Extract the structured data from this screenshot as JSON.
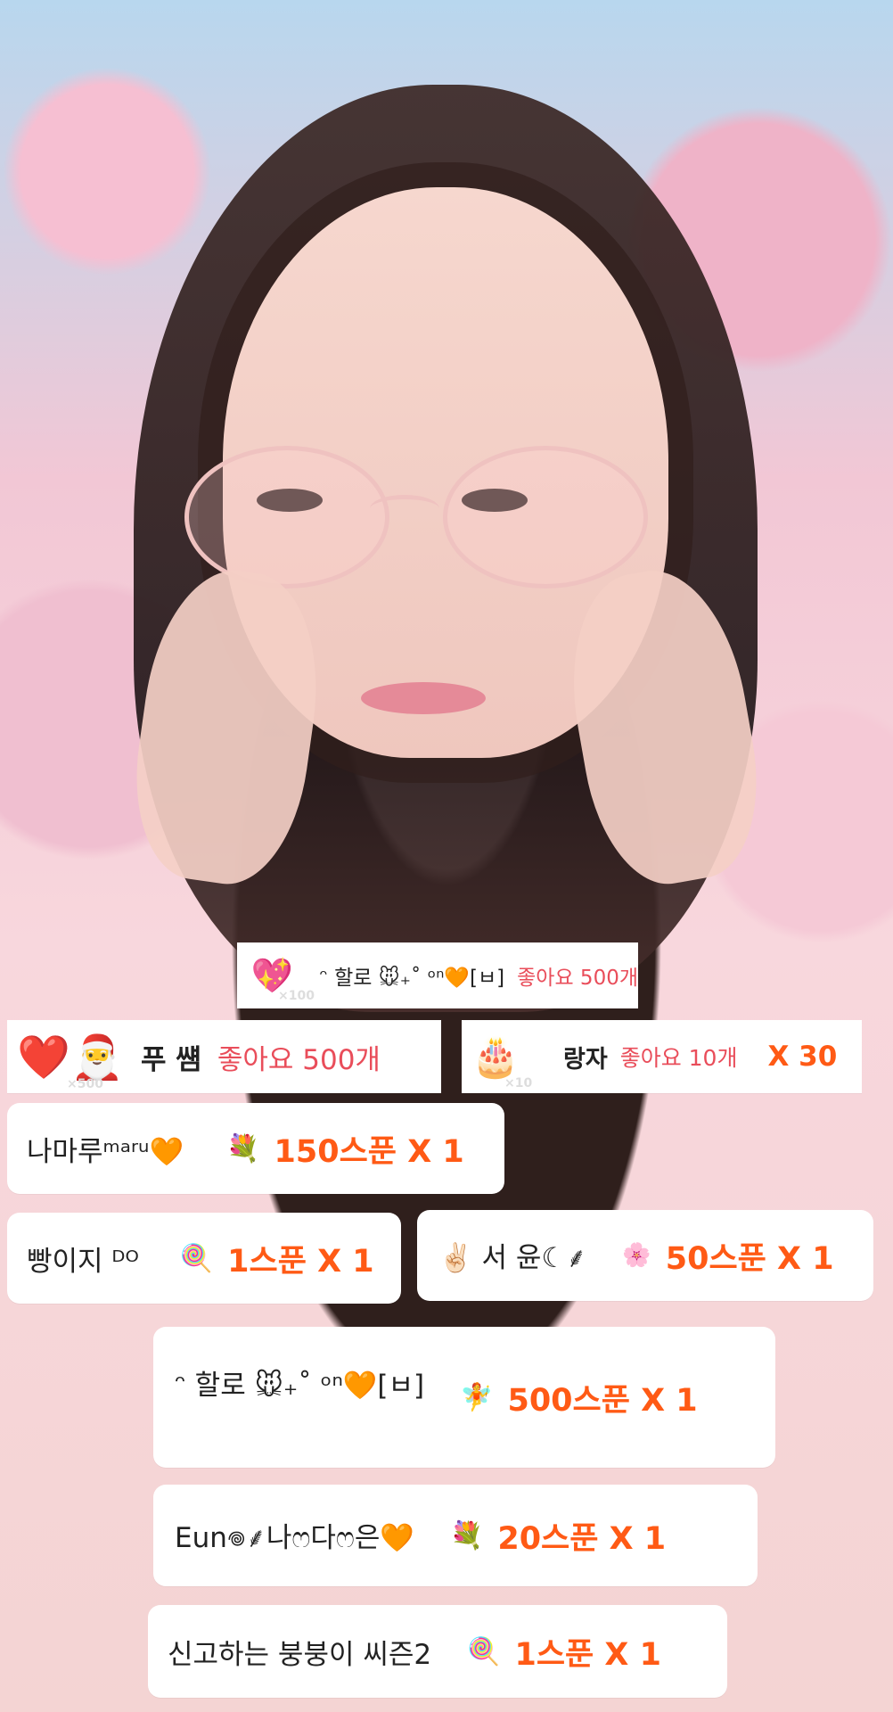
{
  "cards": [
    {
      "name": "ᵔ 할로 🐭₊˚ ᵒⁿ🧡[ㅂ]",
      "message": "좋아요 500개",
      "gift_icon": "💖",
      "gift_count": "×100"
    },
    {
      "name": "푸 썜",
      "message": "좋아요 500개",
      "gift_icon": "❤️🎅",
      "gift_count": "×500"
    },
    {
      "name": "랑자",
      "message": "좋아요 10개",
      "amount": "X 30",
      "gift_icon": "🎂",
      "gift_count": "×10"
    },
    {
      "name": "나마루ᵐᵃʳᵘ🧡",
      "amount": "150스푼 X 1",
      "gift_icon": "💐"
    },
    {
      "name": "빵이지 ᴰᴼ",
      "amount": "1스푼 X 1",
      "gift_icon": "🍭"
    },
    {
      "name": "✌🏻 서 윤☾⸙",
      "amount": "50스푼 X 1",
      "gift_icon": "🌸"
    },
    {
      "name": "ᵔ 할로 🐭₊˚ ᵒⁿ🧡[ㅂ]",
      "amount": "500스푼 X 1",
      "gift_icon": "🧚"
    },
    {
      "name": "Eun𖦹⸙나ෆ다ෆ은🧡",
      "amount": "20스푼 X 1",
      "gift_icon": "💐"
    },
    {
      "name": "신고하는 붕붕이 씨즌2",
      "amount": "1스푼 X 1",
      "gift_icon": "🍭"
    }
  ]
}
